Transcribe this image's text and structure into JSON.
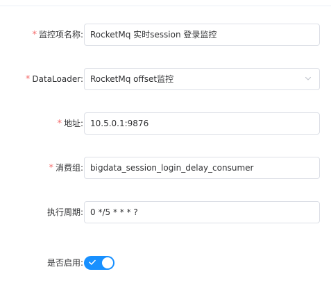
{
  "form": {
    "monitor_name": {
      "required": true,
      "label": "监控项名称:",
      "value": "RocketMq 实时session 登录监控"
    },
    "dataloader": {
      "required": true,
      "label": "DataLoader:",
      "value": "RocketMq offset监控"
    },
    "address": {
      "required": true,
      "label": "地址:",
      "value": "10.5.0.1:9876"
    },
    "consumer_group": {
      "required": true,
      "label": "消费组:",
      "value": "bigdata_session_login_delay_consumer"
    },
    "schedule": {
      "required": false,
      "label": "执行周期:",
      "value": "0 */5 * * * ?"
    },
    "enabled": {
      "required": false,
      "label": "是否启用:",
      "on": true
    }
  },
  "required_mark": "*",
  "colors": {
    "required": "#f56c6c",
    "switch_on": "#1890ff",
    "border": "#dcdfe6"
  },
  "icons": {
    "select_arrow": "chevron-down-icon",
    "switch_check": "check-icon"
  }
}
